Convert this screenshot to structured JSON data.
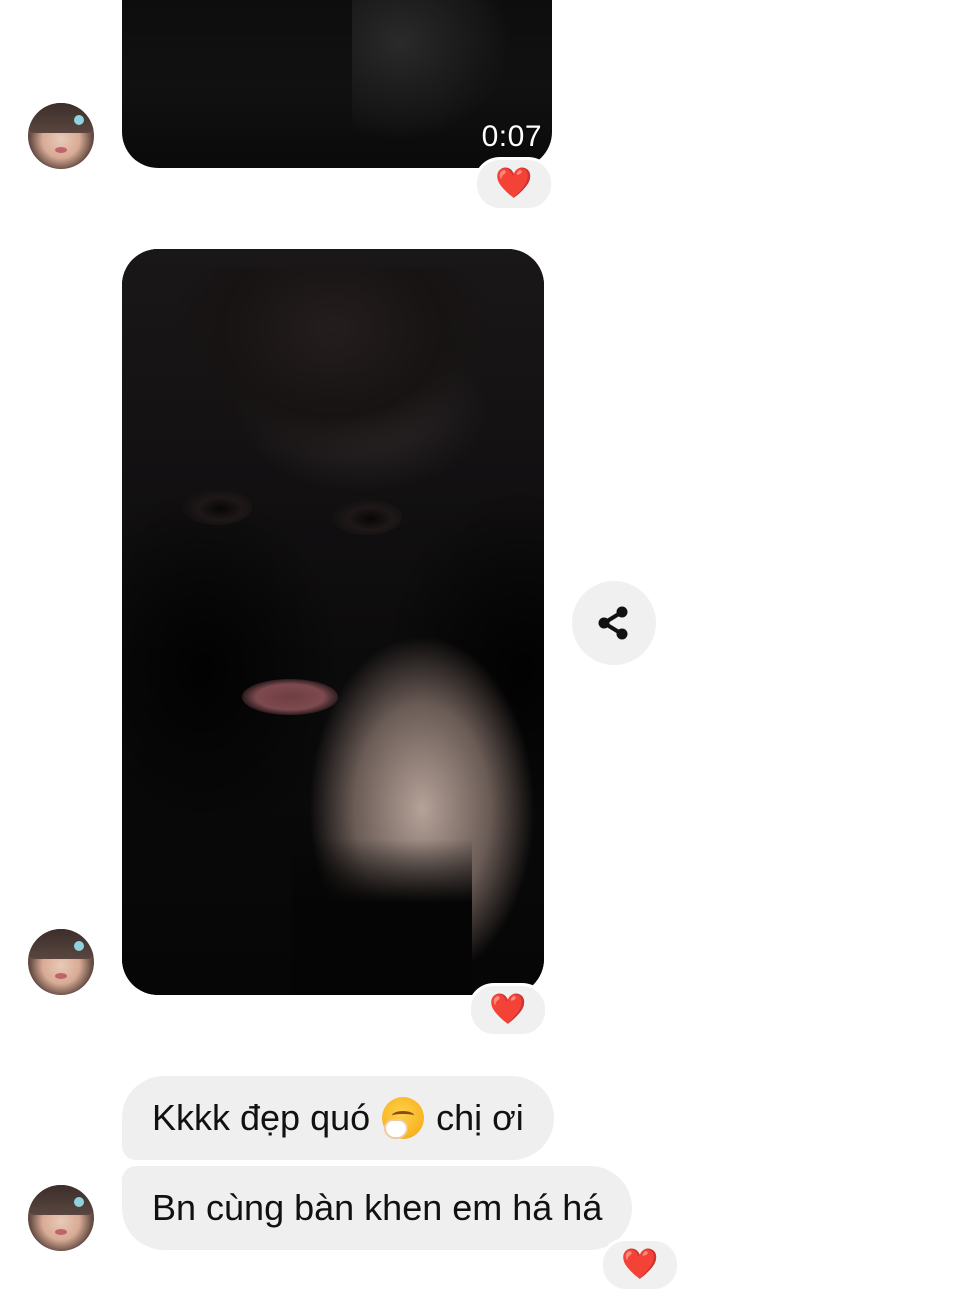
{
  "chat": {
    "video_message": {
      "duration": "0:07",
      "reaction": "❤️"
    },
    "photo_message": {
      "reaction": "❤️",
      "share_icon": "share-icon"
    },
    "text_messages": [
      {
        "text_before_emoji": "Kkkk đẹp quó",
        "emoji": "face-with-hand-over-mouth",
        "text_after_emoji": "chị ơi"
      },
      {
        "text": "Bn cùng bàn khen em há há"
      }
    ],
    "last_reaction": "❤️"
  },
  "colors": {
    "bubble_bg": "#efefef",
    "reaction_heart": "#e2163a",
    "page_bg": "#ffffff"
  }
}
